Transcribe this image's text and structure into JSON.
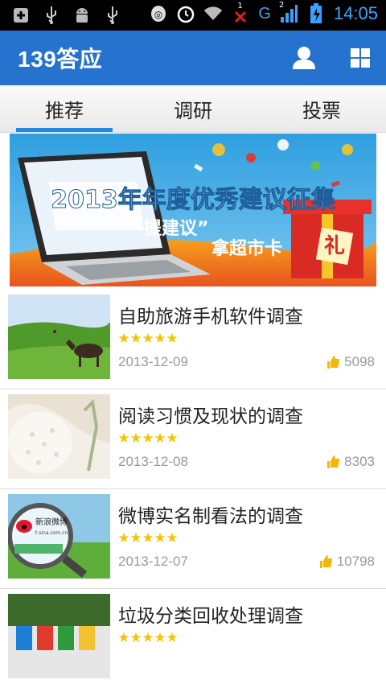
{
  "status_bar": {
    "time": "14:05",
    "network_label": "G",
    "sim_number": "1",
    "signal_number": "2",
    "icons": [
      "add-box-icon",
      "usb-icon",
      "android-icon",
      "usb-icon",
      "sync-icon",
      "alarm-icon",
      "wifi-icon",
      "sim-missing-icon",
      "signal-icon",
      "battery-icon"
    ]
  },
  "app": {
    "title": "139答应",
    "icons": [
      "user-icon",
      "grid-icon"
    ]
  },
  "tabs": [
    {
      "label": "推荐",
      "active": true
    },
    {
      "label": "调研",
      "active": false
    },
    {
      "label": "投票",
      "active": false
    }
  ],
  "banner": {
    "headline": "2013年年度优秀建议征集",
    "sub_left": "“提建议”",
    "sub_right": "拿超市卡",
    "gift_char": "礼",
    "colors": {
      "sky": "#3aa6de",
      "headline": "#ffffff",
      "accent": "#e8312b",
      "gold": "#f6c52a"
    }
  },
  "surveys": [
    {
      "title": "自助旅游手机软件调查",
      "rating": 5,
      "date": "2013-12-09",
      "count": "5098"
    },
    {
      "title": "阅读习惯及现状的调查",
      "rating": 5,
      "date": "2013-12-08",
      "count": "8303"
    },
    {
      "title": "微博实名制看法的调查",
      "rating": 5,
      "date": "2013-12-07",
      "count": "10798"
    },
    {
      "title": "垃圾分类回收处理调查",
      "rating": 5,
      "date": "",
      "count": ""
    }
  ],
  "thumbnail_text": {
    "weibo_logo": "新浪微博",
    "weibo_url": "t.sina.com.cn"
  },
  "colors": {
    "app_bar": "#2573cf",
    "tab_indicator": "#1e8ae6",
    "star": "#f5c400",
    "thumb_up": "#f5b800",
    "meta_text": "#9a9a9a"
  }
}
